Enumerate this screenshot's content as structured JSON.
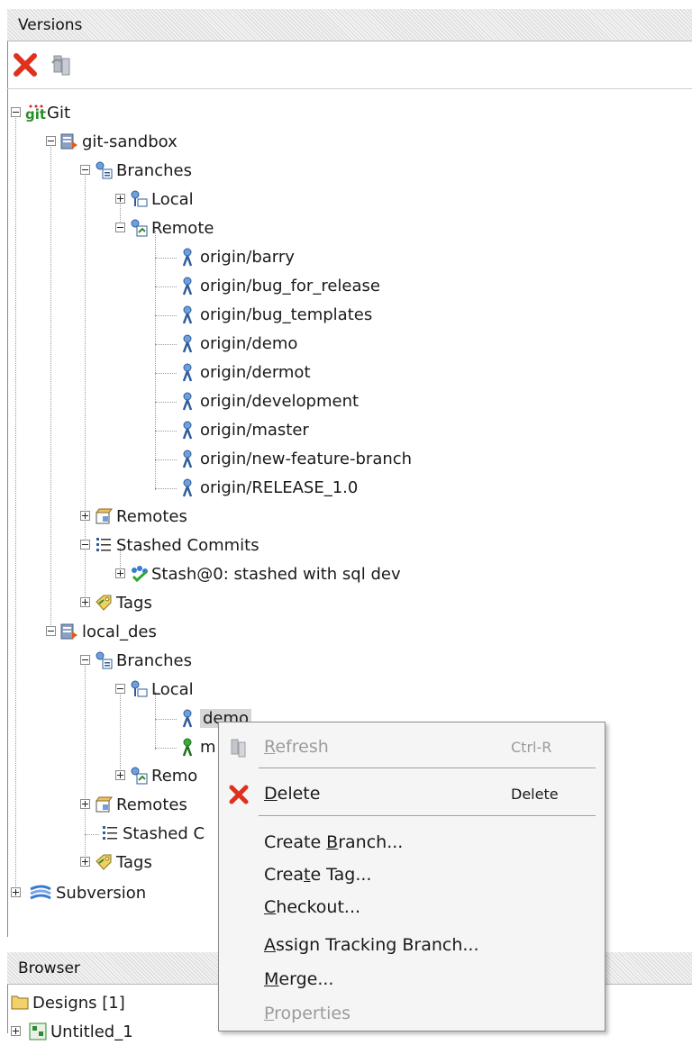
{
  "versions_panel": {
    "title": "Versions"
  },
  "toolbar": {
    "delete_icon": "red-x-icon",
    "refresh_icon": "refresh-icon"
  },
  "tree": {
    "git": "Git",
    "git_sandbox": {
      "name": "git-sandbox",
      "branches": "Branches",
      "local": "Local",
      "remote": "Remote",
      "remote_branches": [
        "origin/barry",
        "origin/bug_for_release",
        "origin/bug_templates",
        "origin/demo",
        "origin/dermot",
        "origin/development",
        "origin/master",
        "origin/new-feature-branch",
        "origin/RELEASE_1.0"
      ],
      "remotes": "Remotes",
      "stashed_commits": "Stashed Commits",
      "stash_item": "Stash@0: stashed with sql dev",
      "tags": "Tags"
    },
    "local_des": {
      "name": "local_des",
      "branches": "Branches",
      "local": "Local",
      "local_branches": [
        "demo",
        "m"
      ],
      "remote": "Remo",
      "remotes": "Remotes",
      "stashed_commits": "Stashed C",
      "tags": "Tags"
    },
    "subversion": "Subversion"
  },
  "context_menu": {
    "refresh": {
      "pre": "",
      "u": "R",
      "post": "efresh",
      "shortcut": "Ctrl-R"
    },
    "delete": {
      "pre": "",
      "u": "D",
      "post": "elete",
      "shortcut": "Delete"
    },
    "create_branch": {
      "pre": "Create ",
      "u": "B",
      "post": "ranch..."
    },
    "create_tag": {
      "pre": "Crea",
      "u": "t",
      "post": "e Tag..."
    },
    "checkout": {
      "pre": "",
      "u": "C",
      "post": "heckout..."
    },
    "assign_tracking": {
      "pre": "",
      "u": "A",
      "post": "ssign Tracking Branch..."
    },
    "merge": {
      "pre": "",
      "u": "M",
      "post": "erge..."
    },
    "properties": {
      "pre": "",
      "u": "P",
      "post": "roperties"
    }
  },
  "browser_panel": {
    "title": "Browser",
    "designs": "Designs [1]",
    "untitled": "Untitled_1"
  }
}
